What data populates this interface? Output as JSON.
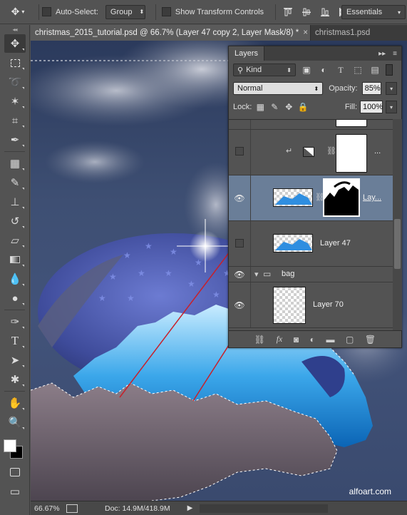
{
  "options_bar": {
    "auto_select_label": "Auto-Select:",
    "auto_select_mode": "Group",
    "show_transform_label": "Show Transform Controls",
    "workspace": "Essentials"
  },
  "document": {
    "tabs": [
      {
        "label": "christmas_2015_tutorial.psd @ 66.7% (Layer 47 copy 2, Layer Mask/8) *",
        "close": "×"
      },
      {
        "label": "christmas1.psd",
        "close": ""
      }
    ]
  },
  "canvas": {
    "watermark": "alfoart.com"
  },
  "status_bar": {
    "zoom": "66.67%",
    "doc_size": "Doc: 14.9M/418.9M",
    "arrow": "▶"
  },
  "layers_panel": {
    "tab_label": "Layers",
    "filter_kind": "Kind",
    "blend_mode": "Normal",
    "opacity_label": "Opacity:",
    "opacity_value": "85%",
    "lock_label": "Lock:",
    "fill_label": "Fill:",
    "fill_value": "100%",
    "layers": [
      {
        "name": "",
        "visible": false
      },
      {
        "name": "...",
        "visible": false
      },
      {
        "name": "Lay...",
        "visible": true,
        "selected": true
      },
      {
        "name": "Layer 47",
        "visible": false
      },
      {
        "name": "bag",
        "visible": true,
        "group": true
      },
      {
        "name": "Layer 70",
        "visible": true
      }
    ]
  },
  "colors": {
    "ui_bg": "#535353",
    "selection": "#6a7e98",
    "annotation_line": "#c8202a"
  }
}
